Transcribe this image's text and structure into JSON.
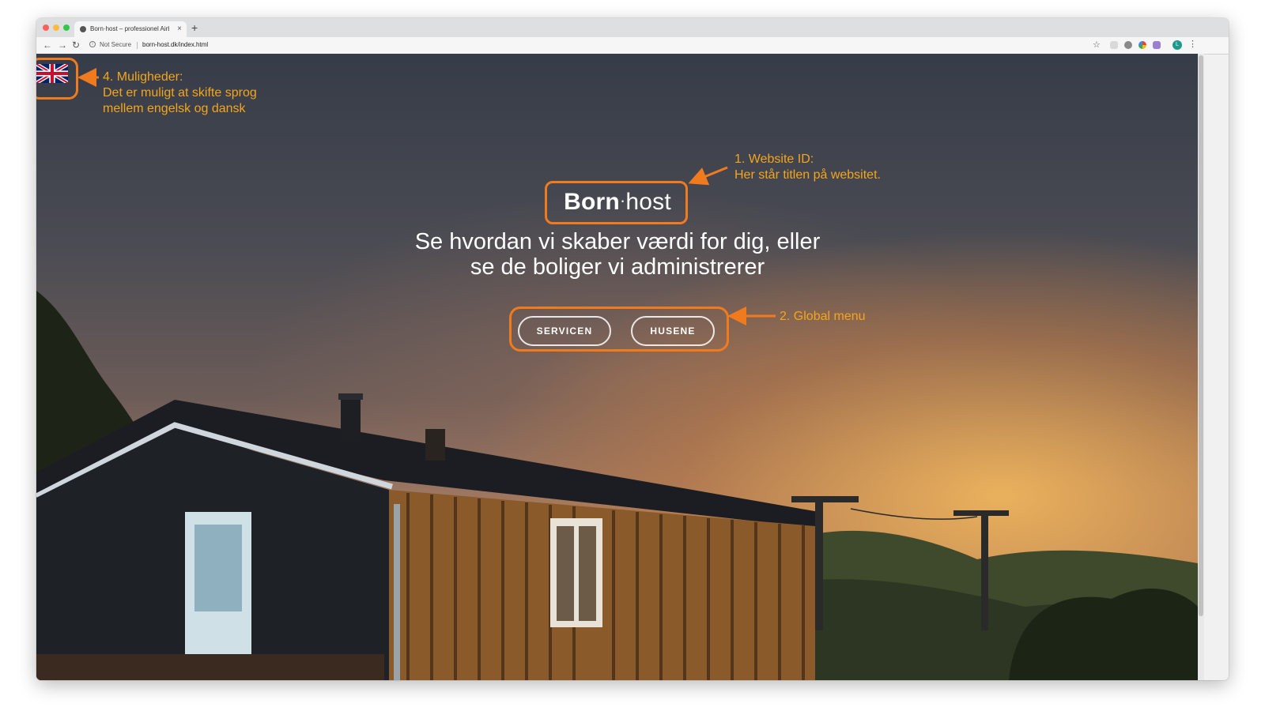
{
  "browser": {
    "tab_title": "Born·host – professionel Airbn",
    "tab_close": "×",
    "new_tab": "+",
    "security_label": "Not Secure",
    "url": "born-host.dk/index.html",
    "profile_initial": "L",
    "icons": [
      "back-arrow-icon",
      "forward-arrow-icon",
      "reload-icon",
      "info-icon",
      "star-icon",
      "menu-dots-icon"
    ]
  },
  "page": {
    "language_flag": "uk-flag-icon",
    "logo": {
      "bold": "Born",
      "separator": "·",
      "light": "host"
    },
    "tagline": "Se hvordan vi skaber værdi for dig, eller se de boliger vi administrerer",
    "menu": [
      {
        "label": "SERVICEN"
      },
      {
        "label": "HUSENE"
      }
    ]
  },
  "annotations": {
    "language": {
      "title": "4. Muligheder:",
      "line1": "Det er muligt at skifte sprog",
      "line2": "mellem engelsk og dansk"
    },
    "website_id": {
      "title": "1. Website ID:",
      "line1": "Her står titlen på websitet."
    },
    "global_menu": {
      "title": "2. Global menu"
    },
    "color": "#f07b1f",
    "text_color": "#f4a51c"
  }
}
